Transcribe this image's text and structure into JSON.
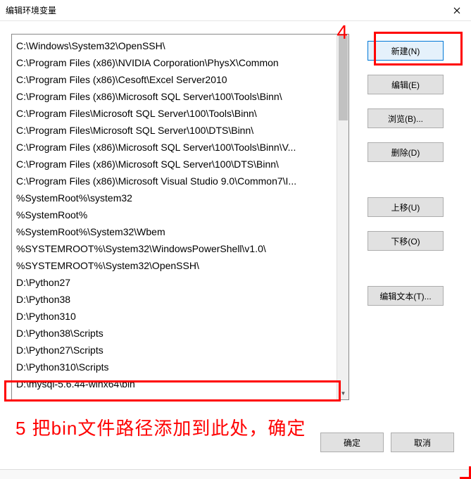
{
  "dialog": {
    "title": "编辑环境变量"
  },
  "paths": [
    "C:\\Windows\\System32\\OpenSSH\\",
    "C:\\Program Files (x86)\\NVIDIA Corporation\\PhysX\\Common",
    "C:\\Program Files (x86)\\Cesoft\\Excel Server2010",
    "C:\\Program Files (x86)\\Microsoft SQL Server\\100\\Tools\\Binn\\",
    "C:\\Program Files\\Microsoft SQL Server\\100\\Tools\\Binn\\",
    "C:\\Program Files\\Microsoft SQL Server\\100\\DTS\\Binn\\",
    "C:\\Program Files (x86)\\Microsoft SQL Server\\100\\Tools\\Binn\\V...",
    "C:\\Program Files (x86)\\Microsoft SQL Server\\100\\DTS\\Binn\\",
    "C:\\Program Files (x86)\\Microsoft Visual Studio 9.0\\Common7\\I...",
    "%SystemRoot%\\system32",
    "%SystemRoot%",
    "%SystemRoot%\\System32\\Wbem",
    "%SYSTEMROOT%\\System32\\WindowsPowerShell\\v1.0\\",
    "%SYSTEMROOT%\\System32\\OpenSSH\\",
    "D:\\Python27",
    "D:\\Python38",
    "D:\\Python310",
    "D:\\Python38\\Scripts",
    "D:\\Python27\\Scripts",
    "D:\\Python310\\Scripts",
    "D:\\mysql-5.6.44-winx64\\bin"
  ],
  "buttons": {
    "new": "新建(N)",
    "edit": "编辑(E)",
    "browse": "浏览(B)...",
    "delete": "删除(D)",
    "moveup": "上移(U)",
    "movedown": "下移(O)",
    "edittext": "编辑文本(T)...",
    "ok": "确定",
    "cancel": "取消"
  },
  "annotations": {
    "num4": "4",
    "note5": "5  把bin文件路径添加到此处，确定"
  }
}
